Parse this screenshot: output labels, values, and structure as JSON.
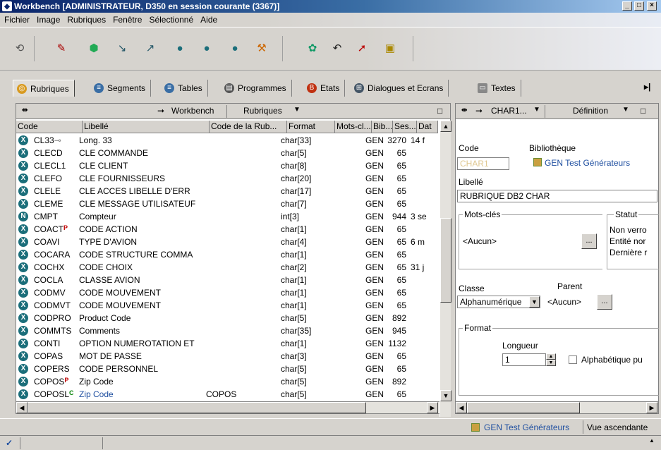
{
  "window": {
    "title": "Workbench [ADMINISTRATEUR, D350 en session courante (3367)]"
  },
  "menu": [
    "Fichier",
    "Image",
    "Rubriques",
    "Fenêtre",
    "Sélectionné",
    "Aide"
  ],
  "tabs": [
    "Rubriques",
    "Segments",
    "Tables",
    "Programmes",
    "Etats",
    "Dialogues et Ecrans",
    "Textes"
  ],
  "left": {
    "nav_workbench": "Workbench",
    "nav_rubriques": "Rubriques",
    "columns": [
      "Code",
      "Libellé",
      "Code de la Rub...",
      "Format",
      "Mots-cl...",
      "Bib...",
      "Ses...",
      "Dat"
    ],
    "rows": [
      {
        "code": "CL33",
        "libelle": "Long. 33",
        "cdr": "",
        "format": "char[33]",
        "mots": "",
        "bib": "GEN",
        "ses": "3270",
        "dat": "14 f",
        "icon": "X",
        "mark": "key",
        "markcolor": "#808080",
        "libcolor": "#000000"
      },
      {
        "code": "CLECD",
        "libelle": "CLE COMMANDE",
        "cdr": "",
        "format": "char[5]",
        "mots": "",
        "bib": "GEN",
        "ses": "65",
        "dat": "",
        "icon": "X",
        "mark": "",
        "markcolor": "",
        "libcolor": "#000000"
      },
      {
        "code": "CLECL1",
        "libelle": "CLE CLIENT",
        "cdr": "",
        "format": "char[8]",
        "mots": "",
        "bib": "GEN",
        "ses": "65",
        "dat": "",
        "icon": "X",
        "mark": "",
        "markcolor": "",
        "libcolor": "#000000"
      },
      {
        "code": "CLEFO",
        "libelle": "CLE FOURNISSEURS",
        "cdr": "",
        "format": "char[20]",
        "mots": "",
        "bib": "GEN",
        "ses": "65",
        "dat": "",
        "icon": "X",
        "mark": "",
        "markcolor": "",
        "libcolor": "#000000"
      },
      {
        "code": "CLELE",
        "libelle": "CLE ACCES LIBELLE D'ERR",
        "cdr": "",
        "format": "char[17]",
        "mots": "",
        "bib": "GEN",
        "ses": "65",
        "dat": "",
        "icon": "X",
        "mark": "",
        "markcolor": "",
        "libcolor": "#000000"
      },
      {
        "code": "CLEME",
        "libelle": "CLE MESSAGE UTILISATEUF",
        "cdr": "",
        "format": "char[7]",
        "mots": "",
        "bib": "GEN",
        "ses": "65",
        "dat": "",
        "icon": "X",
        "mark": "",
        "markcolor": "",
        "libcolor": "#000000"
      },
      {
        "code": "CMPT",
        "libelle": "Compteur",
        "cdr": "",
        "format": "int[3]",
        "mots": "",
        "bib": "GEN",
        "ses": "944",
        "dat": "3 se",
        "icon": "N",
        "mark": "",
        "markcolor": "",
        "libcolor": "#000000"
      },
      {
        "code": "COACT",
        "libelle": "CODE ACTION",
        "cdr": "",
        "format": "char[1]",
        "mots": "",
        "bib": "GEN",
        "ses": "65",
        "dat": "",
        "icon": "X",
        "mark": "P",
        "markcolor": "#c00000",
        "libcolor": "#000000"
      },
      {
        "code": "COAVI",
        "libelle": "TYPE D'AVION",
        "cdr": "",
        "format": "char[4]",
        "mots": "",
        "bib": "GEN",
        "ses": "65",
        "dat": "6 m",
        "icon": "X",
        "mark": "",
        "markcolor": "",
        "libcolor": "#000000"
      },
      {
        "code": "COCARA",
        "libelle": "CODE STRUCTURE COMMA",
        "cdr": "",
        "format": "char[1]",
        "mots": "",
        "bib": "GEN",
        "ses": "65",
        "dat": "",
        "icon": "X",
        "mark": "",
        "markcolor": "",
        "libcolor": "#000000"
      },
      {
        "code": "COCHX",
        "libelle": "CODE CHOIX",
        "cdr": "",
        "format": "char[2]",
        "mots": "",
        "bib": "GEN",
        "ses": "65",
        "dat": "31 j",
        "icon": "X",
        "mark": "",
        "markcolor": "",
        "libcolor": "#000000"
      },
      {
        "code": "COCLA",
        "libelle": "CLASSE AVION",
        "cdr": "",
        "format": "char[1]",
        "mots": "",
        "bib": "GEN",
        "ses": "65",
        "dat": "",
        "icon": "X",
        "mark": "",
        "markcolor": "",
        "libcolor": "#000000"
      },
      {
        "code": "CODMV",
        "libelle": "CODE MOUVEMENT",
        "cdr": "",
        "format": "char[1]",
        "mots": "",
        "bib": "GEN",
        "ses": "65",
        "dat": "",
        "icon": "X",
        "mark": "",
        "markcolor": "",
        "libcolor": "#000000"
      },
      {
        "code": "CODMVT",
        "libelle": "CODE MOUVEMENT",
        "cdr": "",
        "format": "char[1]",
        "mots": "",
        "bib": "GEN",
        "ses": "65",
        "dat": "",
        "icon": "X",
        "mark": "",
        "markcolor": "",
        "libcolor": "#000000"
      },
      {
        "code": "CODPRO",
        "libelle": "Product Code",
        "cdr": "",
        "format": "char[5]",
        "mots": "",
        "bib": "GEN",
        "ses": "892",
        "dat": "",
        "icon": "X",
        "mark": "",
        "markcolor": "",
        "libcolor": "#000000"
      },
      {
        "code": "COMMTS",
        "libelle": "Comments",
        "cdr": "",
        "format": "char[35]",
        "mots": "",
        "bib": "GEN",
        "ses": "945",
        "dat": "",
        "icon": "X",
        "mark": "",
        "markcolor": "",
        "libcolor": "#000000"
      },
      {
        "code": "CONTI",
        "libelle": "OPTION NUMEROTATION ET",
        "cdr": "",
        "format": "char[1]",
        "mots": "",
        "bib": "GEN",
        "ses": "1132",
        "dat": "",
        "icon": "X",
        "mark": "",
        "markcolor": "",
        "libcolor": "#000000"
      },
      {
        "code": "COPAS",
        "libelle": "MOT DE PASSE",
        "cdr": "",
        "format": "char[3]",
        "mots": "",
        "bib": "GEN",
        "ses": "65",
        "dat": "",
        "icon": "X",
        "mark": "",
        "markcolor": "",
        "libcolor": "#000000"
      },
      {
        "code": "COPERS",
        "libelle": "CODE PERSONNEL",
        "cdr": "",
        "format": "char[5]",
        "mots": "",
        "bib": "GEN",
        "ses": "65",
        "dat": "",
        "icon": "X",
        "mark": "",
        "markcolor": "",
        "libcolor": "#000000"
      },
      {
        "code": "COPOS",
        "libelle": "Zip Code",
        "cdr": "",
        "format": "char[5]",
        "mots": "",
        "bib": "GEN",
        "ses": "892",
        "dat": "",
        "icon": "X",
        "mark": "P",
        "markcolor": "#c00000",
        "libcolor": "#000000"
      },
      {
        "code": "COPOSL",
        "libelle": "Zip Code",
        "cdr": "COPOS",
        "format": "char[5]",
        "mots": "",
        "bib": "GEN",
        "ses": "65",
        "dat": "",
        "icon": "X",
        "mark": "C",
        "markcolor": "#008000",
        "libcolor": "#1f4fa0"
      }
    ]
  },
  "right": {
    "nav_field": "CHAR1...",
    "nav_definition": "Définition",
    "label_code": "Code",
    "label_bibliotheque": "Bibliothèque",
    "code_value": "CHAR1",
    "bibliotheque_value": "GEN Test Générateurs",
    "label_libelle": "Libellé",
    "libelle_value": "RUBRIQUE DB2 CHAR",
    "group_mots": "Mots-clés",
    "mots_value": "<Aucun>",
    "ellipsis": "...",
    "group_statut": "Statut",
    "statut_lines": [
      "Non verro",
      "Entité nor",
      "Dernière r"
    ],
    "label_classe": "Classe",
    "classe_value": "Alphanumérique",
    "label_parent": "Parent",
    "parent_value": "<Aucun>",
    "group_format": "Format",
    "label_longueur": "Longueur",
    "longueur_value": "1",
    "alpha_label": "Alphabétique pu"
  },
  "status": {
    "library": "GEN Test Générateurs",
    "view": "Vue ascendante"
  },
  "colors": {
    "accent": "#0a246a",
    "row_icon": "#1b6e7a",
    "link": "#1f4fa0"
  }
}
